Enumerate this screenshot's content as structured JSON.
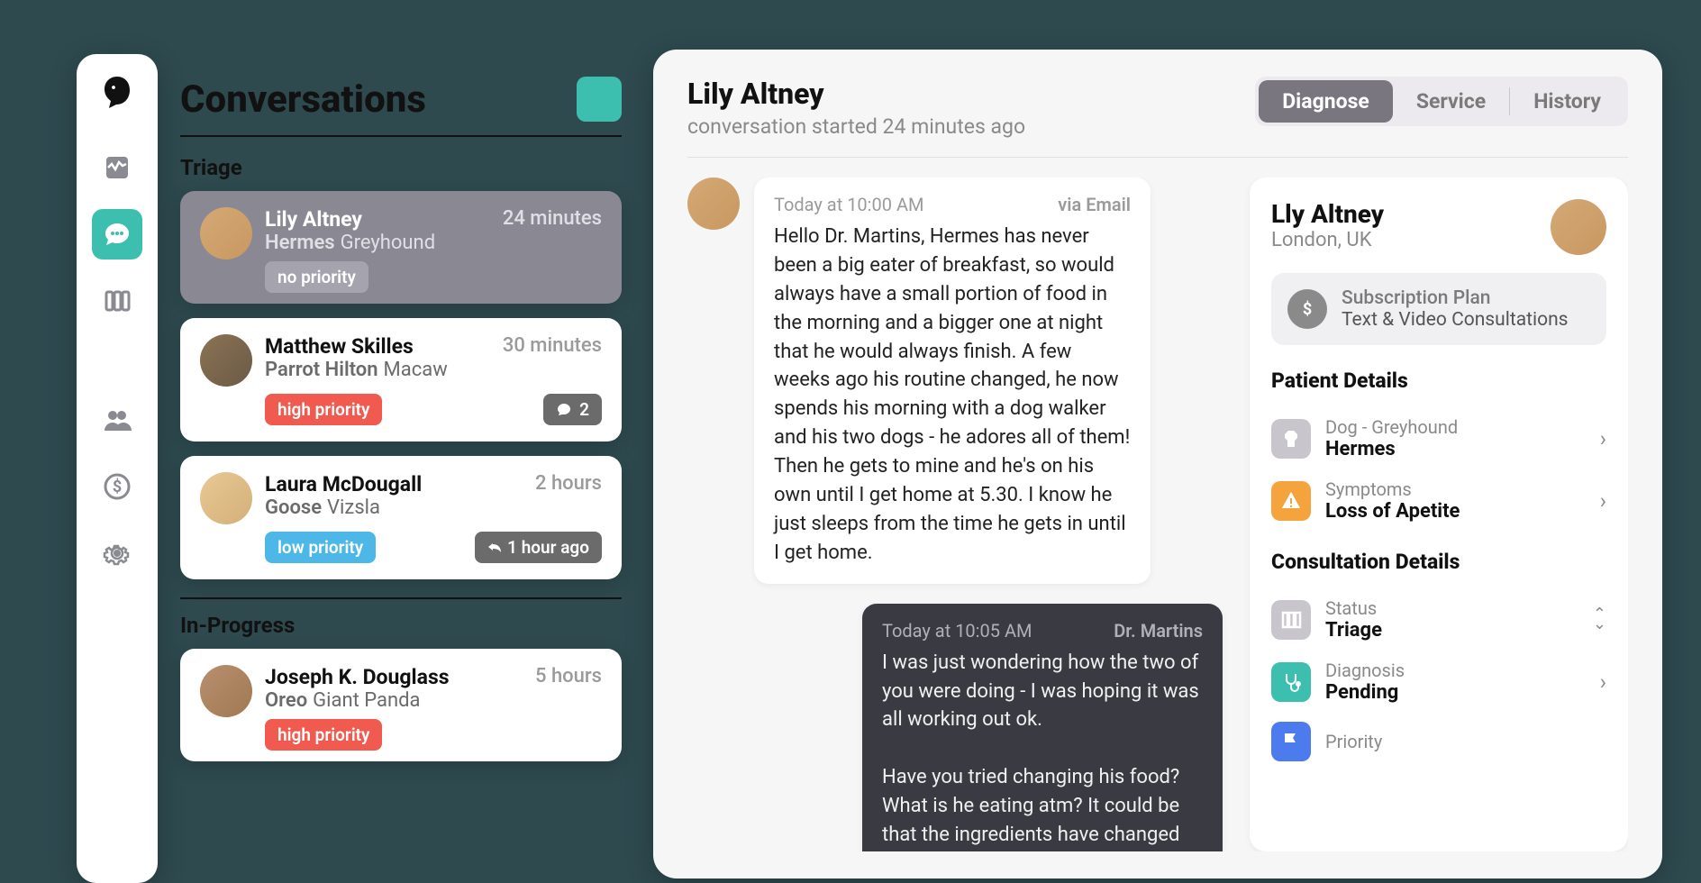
{
  "sidebar": {
    "items": [
      "dashboard",
      "conversations",
      "board",
      "users",
      "billing",
      "settings"
    ]
  },
  "conversations": {
    "title": "Conversations",
    "sections": {
      "triage": "Triage",
      "inprogress": "In-Progress"
    },
    "items": [
      {
        "name": "Lily Altney",
        "pet": "Hermes",
        "breed": "Greyhound",
        "time": "24 minutes",
        "priority": "no priority",
        "priority_class": "none",
        "selected": true
      },
      {
        "name": "Matthew Skilles",
        "pet": "Parrot Hilton",
        "breed": "Macaw",
        "time": "30 minutes",
        "priority": "high priority",
        "priority_class": "high",
        "msg_count": "2"
      },
      {
        "name": "Laura McDougall",
        "pet": "Goose",
        "breed": "Vizsla",
        "time": "2 hours",
        "priority": "low priority",
        "priority_class": "low",
        "reply": "1 hour ago"
      },
      {
        "name": "Joseph K. Douglass",
        "pet": "Oreo",
        "breed": "Giant Panda",
        "time": "5 hours",
        "priority": "high priority",
        "priority_class": "high"
      }
    ]
  },
  "detail": {
    "header": {
      "name": "Lily Altney",
      "sub": "conversation started 24 minutes ago"
    },
    "tabs": {
      "diagnose": "Diagnose",
      "service": "Service",
      "history": "History"
    },
    "messages": [
      {
        "time": "Today at 10:00 AM",
        "via": "via Email",
        "text": "Hello Dr. Martins, Hermes has never been a big eater of breakfast, so would always have a small portion of food in the morning and a bigger one at night that he would always finish. A few weeks ago his routine changed, he now spends his morning with a dog walker and his two dogs - he adores all of them! Then he gets to mine and he's on his own until I get home at 5.30. I know he just sleeps from the time he gets in until I get home."
      },
      {
        "time": "Today at 10:05 AM",
        "from": "Dr. Martins",
        "text": "I was just wondering how the two of you were doing - I was hoping it was all working out ok.\n\nHave you tried changing his food? What is he eating atm? It could be that the ingredients have changed"
      }
    ],
    "info": {
      "name": "Lly Altney",
      "location": "London, UK",
      "subscription": {
        "label": "Subscription Plan",
        "value": "Text & Video Consultations"
      },
      "patient": {
        "title": "Patient Details",
        "animal": {
          "label": "Dog - Greyhound",
          "value": "Hermes"
        },
        "symptoms": {
          "label": "Symptoms",
          "value": "Loss of Apetite"
        }
      },
      "consultation": {
        "title": "Consultation Details",
        "status": {
          "label": "Status",
          "value": "Triage"
        },
        "diagnosis": {
          "label": "Diagnosis",
          "value": "Pending"
        },
        "priority": {
          "label": "Priority"
        }
      }
    }
  }
}
